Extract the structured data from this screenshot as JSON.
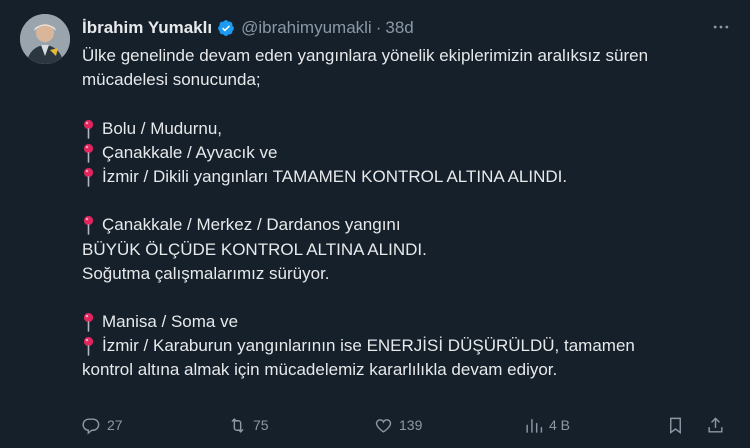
{
  "author": {
    "name": "İbrahim Yumaklı",
    "handle": "@ibrahimyumakli",
    "separator": "·",
    "time": "38d"
  },
  "tweet": {
    "lines": [
      {
        "pin": false,
        "text": "Ülke genelinde devam eden yangınlara yönelik ekiplerimizin aralıksız süren"
      },
      {
        "pin": false,
        "text": "mücadelesi sonucunda;"
      },
      {
        "pin": false,
        "text": ""
      },
      {
        "pin": true,
        "text": "Bolu / Mudurnu,"
      },
      {
        "pin": true,
        "text": "Çanakkale / Ayvacık ve"
      },
      {
        "pin": true,
        "text": "İzmir / Dikili yangınları TAMAMEN KONTROL ALTINA ALINDI."
      },
      {
        "pin": false,
        "text": ""
      },
      {
        "pin": true,
        "text": "Çanakkale / Merkez / Dardanos yangını"
      },
      {
        "pin": false,
        "text": "BÜYÜK ÖLÇÜDE KONTROL ALTINA ALINDI."
      },
      {
        "pin": false,
        "text": "Soğutma çalışmalarımız sürüyor."
      },
      {
        "pin": false,
        "text": ""
      },
      {
        "pin": true,
        "text": "Manisa / Soma ve"
      },
      {
        "pin": true,
        "text": "İzmir / Karaburun yangınlarının ise ENERJİSİ DÜŞÜRÜLDÜ, tamamen"
      },
      {
        "pin": false,
        "text": "kontrol altına almak için mücadelemiz kararlılıkla devam ediyor."
      }
    ]
  },
  "actions": {
    "replies": "27",
    "retweets": "75",
    "likes": "139",
    "views": "4 B"
  },
  "colors": {
    "background": "#15202b",
    "text": "#e7e9ea",
    "secondary": "#8b98a5",
    "verified": "#1d9bf0",
    "pin": "#e0245e"
  },
  "icons": [
    "verified-badge-icon",
    "more-icon",
    "pin-icon",
    "reply-icon",
    "retweet-icon",
    "like-icon",
    "views-icon",
    "bookmark-icon",
    "share-icon"
  ]
}
